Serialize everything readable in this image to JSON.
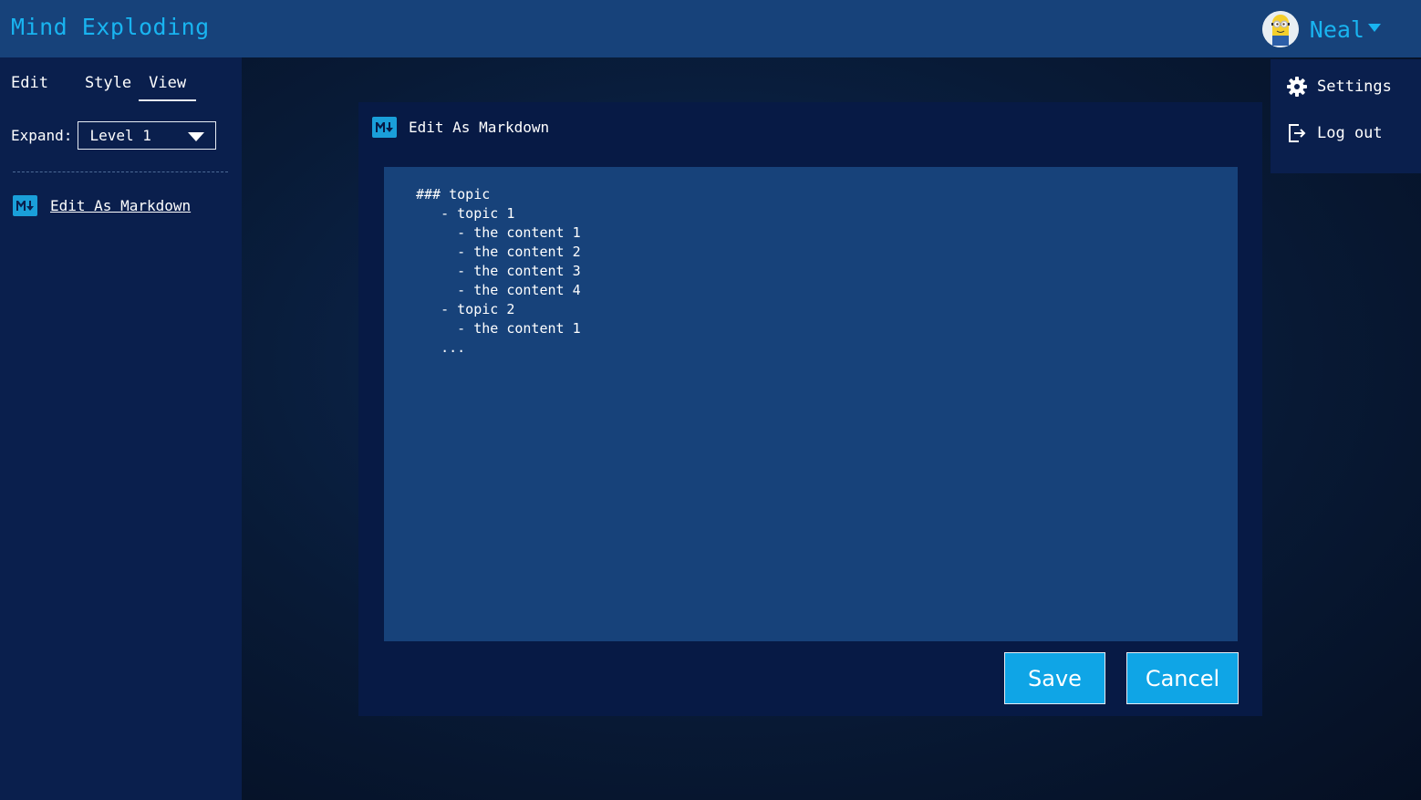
{
  "app": {
    "title": "Mind Exploding"
  },
  "user": {
    "name": "Neal"
  },
  "sidebar": {
    "tabs": [
      {
        "label": "Edit"
      },
      {
        "label": "Style"
      },
      {
        "label": "View",
        "active": true
      }
    ],
    "expand": {
      "label": "Expand:",
      "value": "Level 1"
    },
    "markdown_link": {
      "label": "Edit As Markdown",
      "icon": "markdown-icon"
    }
  },
  "menu": {
    "items": [
      {
        "label": "Settings",
        "icon": "gear-icon"
      },
      {
        "label": "Log out",
        "icon": "logout-icon"
      }
    ]
  },
  "dialog": {
    "title": "Edit As Markdown",
    "content": "### topic\n   - topic 1\n     - the content 1\n     - the content 2\n     - the content 3\n     - the content 4\n   - topic 2\n     - the content 1\n   ...",
    "save_label": "Save",
    "cancel_label": "Cancel"
  },
  "colors": {
    "accent": "#19b4f0",
    "header_bg": "#17427a",
    "panel_bg": "#0a1f4d",
    "button_bg": "#0fa5e6"
  }
}
